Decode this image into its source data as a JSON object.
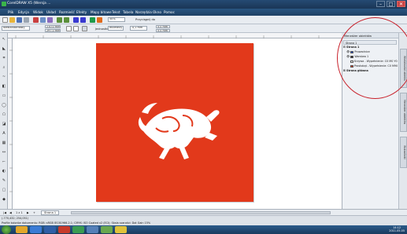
{
  "window": {
    "title": "CorelDRAW X5 (Wersja ...",
    "controls": [
      "–",
      "□",
      "✕"
    ]
  },
  "menu": [
    "Plik",
    "Edycja",
    "Widok",
    "Układ",
    "Rozmieść",
    "Efekty",
    "Mapy bitowe",
    "Tekst",
    "Tabela",
    "Narzędzia",
    "Okno",
    "Pomoc"
  ],
  "toolbar1": {
    "zoom": "50%",
    "snap_label": "Przyciągnij do"
  },
  "toolbar2": {
    "paper_preset": "Niestandardowy",
    "width": "210,0 mm",
    "height": "297,0 mm",
    "units_label": "Jednostki:",
    "units_value": "milimetry",
    "nudge": ".0,1 mm",
    "dup_x": "5,0 mm",
    "dup_y": "5,0 mm"
  },
  "docker": {
    "title": "Menedżer obiektów",
    "page_label": "Strona 1",
    "layer_root": "Strona 1",
    "items": [
      {
        "label": "Prowadnice",
        "color": "#1d4fd8"
      },
      {
        "label": "Warstwa 1",
        "color": "#222222"
      },
      {
        "label": "Krzywa - Wypełnienie: C0 M0 Y0 K0",
        "color": "#ffffff"
      },
      {
        "label": "Prostokąt - Wypełnienie: C0 M90",
        "color": "#e2391b"
      }
    ],
    "master": "Strona główna"
  },
  "side_tabs": [
    "Właściwości obiektu",
    "Menedżer obiektów",
    "Wskazówki"
  ],
  "pagebar": {
    "counter": "1 z 1",
    "page_tab": "Strona 1"
  },
  "status": {
    "line1": "(-770,432; 254,051)",
    "line2": "Profile kolorów dokumentu: RGB: sRGB IEC61966-2.1; CMYK: ISO Coated v2 (ECI); Skala szarości: Dot Gain 15%"
  },
  "clock": {
    "time": "14:12",
    "date": "2011-05-05"
  },
  "colors": {
    "artboard": "#e2391b",
    "annotation": "#c8202a"
  }
}
